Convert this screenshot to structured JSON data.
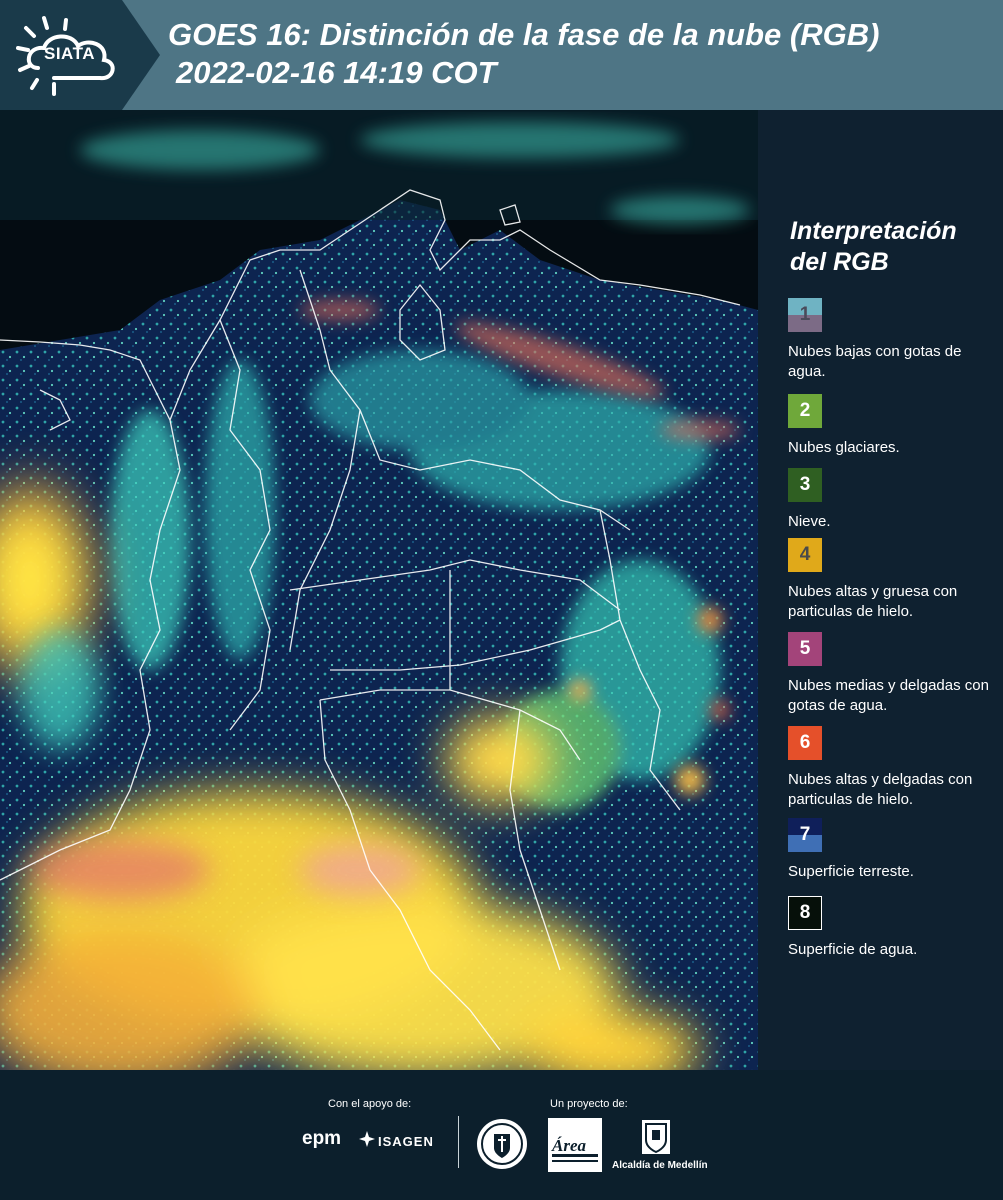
{
  "header": {
    "logo_text": "SIATA",
    "title_line1": "GOES 16: Distinción de la fase de la nube (RGB)",
    "title_line2": "2022-02-16 14:19 COT"
  },
  "legend": {
    "title": "Interpretación del RGB",
    "items": [
      {
        "number": "1",
        "label": "Nubes bajas con gotas de agua.",
        "color_top": "#6fb3c3",
        "color_bottom": "#7c6b86",
        "text_color": "#4a4a5a"
      },
      {
        "number": "2",
        "label": "Nubes glaciares.",
        "color": "#6fa83a",
        "text_color": "#ffffff"
      },
      {
        "number": "3",
        "label": "Nieve.",
        "color": "#2f5f22",
        "text_color": "#ffffff"
      },
      {
        "number": "4",
        "label": "Nubes altas y gruesa con particulas de hielo.",
        "color": "#e0a91a",
        "text_color": "#4a4a4a"
      },
      {
        "number": "5",
        "label": "Nubes medias y delgadas con gotas de agua.",
        "color": "#a3447a",
        "text_color": "#ffffff"
      },
      {
        "number": "6",
        "label": "Nubes altas y delgadas con particulas de hielo.",
        "color": "#e5502a",
        "text_color": "#ffffff"
      },
      {
        "number": "7",
        "label": "Superficie terreste.",
        "color_top": "#0f1f5a",
        "color_bottom": "#3f6fb5",
        "text_color": "#ffffff"
      },
      {
        "number": "8",
        "label": "Superficie de agua.",
        "color": "#06100a",
        "text_color": "#ffffff",
        "border": "#ffffff"
      }
    ]
  },
  "footer": {
    "support_caption": "Con el apoyo de:",
    "project_caption": "Un proyecto de:",
    "epm": "epm",
    "isagen": "ISAGEN",
    "area_logo": "Área",
    "alcaldia": "Alcaldía de Medellín"
  },
  "colors": {
    "header_bg": "#4e7585",
    "logo_tab_bg": "#1a3a4a",
    "page_bg": "#0c1f2c",
    "legend_bg": "#0f2130"
  },
  "icons": {
    "logo": "siata-sun-cloud-logo",
    "seal": "university-seal-icon",
    "alcaldia": "coat-of-arms-icon"
  }
}
